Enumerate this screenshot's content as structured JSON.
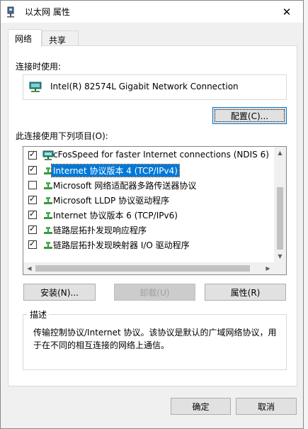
{
  "window": {
    "title": "以太网 属性",
    "close_glyph": "✕"
  },
  "tabs": [
    {
      "label": "网络",
      "active": true
    },
    {
      "label": "共享",
      "active": false
    }
  ],
  "connect_using": {
    "label": "连接时使用:",
    "adapter_name": "Intel(R) 82574L Gigabit Network Connection",
    "configure_button": "配置(C)..."
  },
  "items": {
    "label": "此连接使用下列项目(O):",
    "list": [
      {
        "text": "cFosSpeed for faster Internet connections (NDIS 6)",
        "checked": true,
        "icon": "cfos-icon",
        "selected": false
      },
      {
        "text": "Internet 协议版本 4 (TCP/IPv4)",
        "checked": true,
        "icon": "protocol-icon",
        "selected": true
      },
      {
        "text": "Microsoft 网络适配器多路传送器协议",
        "checked": false,
        "icon": "protocol-icon",
        "selected": false
      },
      {
        "text": "Microsoft LLDP 协议驱动程序",
        "checked": true,
        "icon": "protocol-icon",
        "selected": false
      },
      {
        "text": "Internet 协议版本 6 (TCP/IPv6)",
        "checked": true,
        "icon": "protocol-icon",
        "selected": false
      },
      {
        "text": "链路层拓扑发现响应程序",
        "checked": true,
        "icon": "protocol-icon",
        "selected": false
      },
      {
        "text": "链路层拓扑发现映射器 I/O 驱动程序",
        "checked": true,
        "icon": "protocol-icon",
        "selected": false
      }
    ]
  },
  "buttons": {
    "install": "安装(N)...",
    "uninstall": "卸载(U)",
    "properties": "属性(R)",
    "ok": "确定",
    "cancel": "取消"
  },
  "description": {
    "legend": "描述",
    "text": "传输控制协议/Internet 协议。该协议是默认的广域网络协议，用于在不同的相互连接的网络上通信。"
  },
  "colors": {
    "selection": "#0078d7",
    "protocol_green": "#3a9a3a",
    "monitor_teal": "#2a8a8a"
  }
}
